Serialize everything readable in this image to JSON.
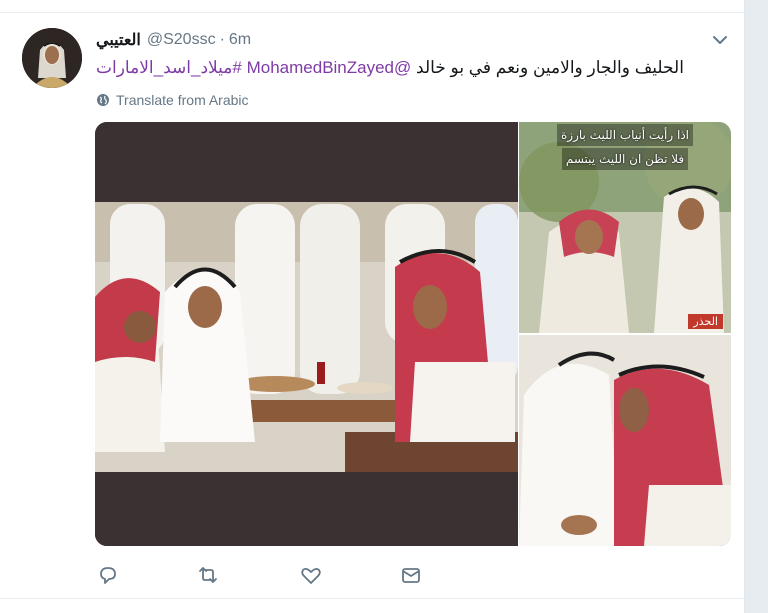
{
  "tweet": {
    "author_name": "العتيبي",
    "handle": "@S20ssc",
    "separator": "·",
    "time": "6m",
    "text_prefix": "الحليف والجار والامين ونعم في بو خالد",
    "mention": "@MohamedBinZayed",
    "hashtag": "#ميلاد_اسد_الامارات",
    "translate_label": "Translate from Arabic"
  },
  "media": {
    "top_right_caption_line1": "اذا رأيت أنياب الليث بارزة",
    "top_right_caption_line2": "فلا تظن ان الليث يبتسم",
    "top_right_badge": "الحذر"
  },
  "icons": {
    "caret": "chevron-down-icon",
    "translate": "globe-icon",
    "reply": "reply-icon",
    "retweet": "retweet-icon",
    "like": "heart-icon",
    "dm": "envelope-icon"
  },
  "colors": {
    "link": "#7e3ba6",
    "secondary_text": "#657786",
    "background": "#e6ecf0"
  }
}
